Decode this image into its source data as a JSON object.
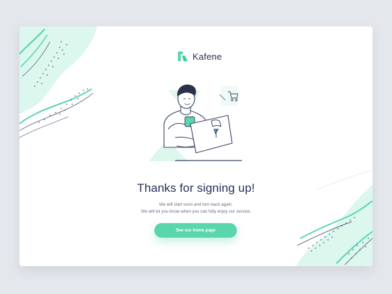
{
  "brand": {
    "name": "Kafene",
    "icon": "kafene-logo-icon"
  },
  "message": {
    "headline": "Thanks for signing up!",
    "line1": "We will start soon and turn back again.",
    "line2": "We will let you know when you can fully enjoy our service."
  },
  "cta": {
    "label": "See our home page"
  },
  "colors": {
    "accent": "#5ad6ac",
    "mint": "#d9f7ec",
    "text": "#273058"
  }
}
